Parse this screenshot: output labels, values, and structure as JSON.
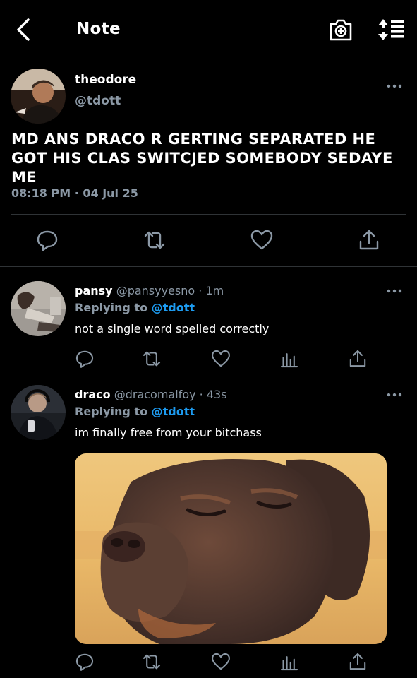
{
  "header": {
    "title": "Note"
  },
  "main_tweet": {
    "name": "theodore",
    "handle": "@tdott",
    "text": "MD ANS DRACO R GERTING SEPARATED HE GOT HIS CLAS SWITCJED SOMEBODY SEDAYE ME",
    "timestamp": "08:18 PM · 04 Jul 25"
  },
  "replies": [
    {
      "name": "pansy",
      "handle": "@pansyyesno",
      "sep": " · ",
      "time": "1m",
      "replying_prefix": "Replying to ",
      "replying_to": "@tdott",
      "text": "not a single word spelled correctly"
    },
    {
      "name": "draco",
      "handle": "@dracomalfoy",
      "sep": " · ",
      "time": "43s",
      "replying_prefix": "Replying to ",
      "replying_to": "@tdott",
      "text": "im finally free from your bitchass",
      "media": "dog-photo"
    }
  ],
  "icons": {
    "back": "chevron-left-icon",
    "camera": "camera-plus-icon",
    "sort": "sort-list-icon",
    "more": "more-dots-icon",
    "reply": "reply-bubble-icon",
    "retweet": "retweet-icon",
    "like": "heart-icon",
    "analytics": "analytics-bars-icon",
    "share": "share-icon"
  },
  "colors": {
    "background": "#000000",
    "secondary_text": "#8b98a5",
    "accent": "#1d9bf0",
    "divider": "#2f3336"
  }
}
